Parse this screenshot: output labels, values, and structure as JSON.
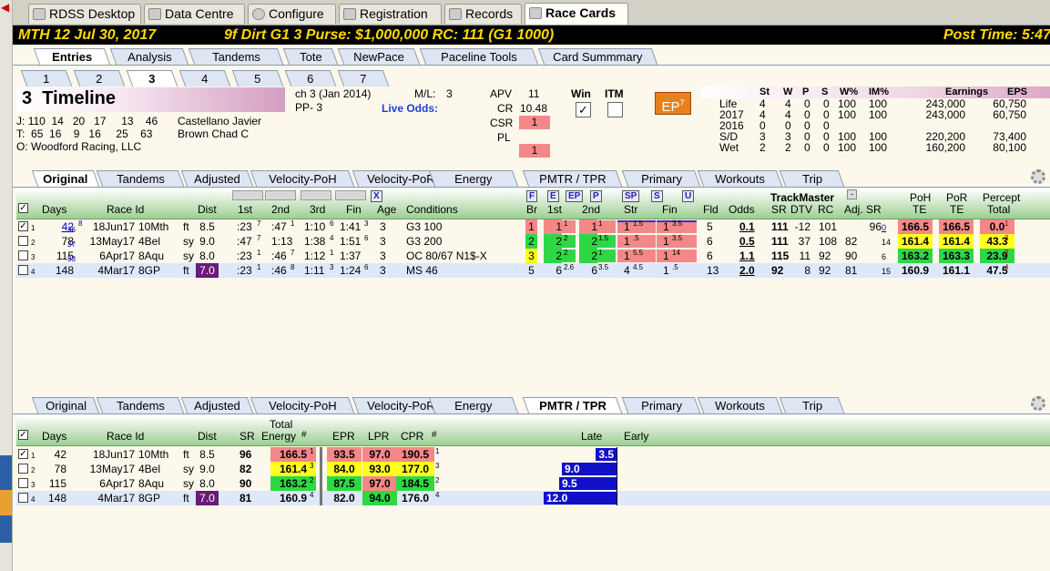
{
  "app_tabs": [
    "RDSS Desktop",
    "Data Centre",
    "Configure",
    "Registration",
    "Records",
    "Race Cards"
  ],
  "header": {
    "left": "MTH  12  Jul 30, 2017",
    "mid": "9f  Dirt   G1  3   Purse: $1,000,000   RC: 111  (G1 1000)",
    "right": "Post Time: 5:47"
  },
  "main_tabs": [
    "Entries",
    "Analysis",
    "Tandems",
    "Tote",
    "NewPace",
    "Paceline Tools",
    "Card Summmary"
  ],
  "race_tabs": [
    "1",
    "2",
    "3",
    "4",
    "5",
    "6",
    "7"
  ],
  "horse": {
    "num": "3",
    "name": "Timeline",
    "j_label": "J:",
    "j_stats": "110  14   20   17     13    46",
    "jockey": "Castellano Javier",
    "t_label": "T:",
    "t_stats": " 65  16    9   16     25    63",
    "trainer": "Brown Chad C",
    "o_label": "O:",
    "owner": "Woodford Racing, LLC",
    "desc": "ch  3  (Jan 2014)",
    "pp": "PP- 3",
    "ml_label": "M/L:",
    "ml": "3",
    "live_odds": "Live Odds:",
    "apv_label": "APV",
    "apv": "11",
    "cr_label": "CR",
    "cr": "10.48",
    "csr_label": "CSR",
    "csr": "1",
    "pl_label": "PL",
    "pl": "1",
    "win_label": "Win",
    "itm_label": "ITM",
    "ep_label": "EP",
    "ep_sup": "7"
  },
  "stats": {
    "headers": [
      "St",
      "W",
      "P",
      "S",
      "W%",
      "IM%",
      "Earnings",
      "EPS"
    ],
    "rows": [
      [
        "Life",
        "4",
        "4",
        "0",
        "0",
        "100",
        "100",
        "243,000",
        "60,750"
      ],
      [
        "2017",
        "4",
        "4",
        "0",
        "0",
        "100",
        "100",
        "243,000",
        "60,750"
      ],
      [
        "2016",
        "0",
        "0",
        "0",
        "0",
        "",
        "",
        "",
        ""
      ],
      [
        "S/D",
        "3",
        "3",
        "0",
        "0",
        "100",
        "100",
        "220,200",
        "73,400"
      ],
      [
        "Wet",
        "2",
        "2",
        "0",
        "0",
        "100",
        "100",
        "160,200",
        "80,100"
      ]
    ]
  },
  "pp_tabs": [
    "Original",
    "Tandems",
    "Adjusted",
    "Velocity-PoH",
    "Velocity-PoR",
    "Energy",
    "PMTR / TPR",
    "Primary",
    "Workouts",
    "Trip"
  ],
  "grid1": {
    "headers": {
      "days": "Days",
      "raceid": "Race Id",
      "dist": "Dist",
      "c1": "1st",
      "c2": "2nd",
      "c3": "3rd",
      "fin": "Fin",
      "age": "Age",
      "cond": "Conditions",
      "br": "Br",
      "first": "1st",
      "second": "2nd",
      "str": "Str",
      "fin2": "Fin",
      "fld": "Fld",
      "odds": "Odds",
      "tm": "TrackMaster",
      "sr": "SR",
      "dtv": "DTV",
      "rc": "RC",
      "adjsr": "Adj. SR",
      "poh": "PoH",
      "te": "TE",
      "por": "PoR",
      "te2": "TE",
      "percept": "Percept",
      "total": "Total",
      "f": "F",
      "e": "E",
      "ep": "EP",
      "p": "P",
      "sp": "SP",
      "s": "S",
      "u": "U",
      "x": "X",
      "minus": "-"
    },
    "rows": [
      {
        "n": "1",
        "days": "42",
        "dsup": "8",
        "dsub": "36",
        "date": "18Jun17",
        "trk": "10Mth",
        "surf": "ft",
        "dist": "8.5",
        "t1": ":23",
        "t1s": "7",
        "t2": ":47",
        "t2s": "1",
        "t3": "1:10",
        "t3s": "6",
        "fin": "1:41",
        "fins": "3",
        "age": "3",
        "cond": "G3 100",
        "br": "1",
        "f1": "1",
        "f1s": "1",
        "s2": "1",
        "s2s": "1",
        "st": "1",
        "sts": "1.5",
        "fn": "1",
        "fns": "3.5",
        "fld": "5",
        "odds": "0.1",
        "sr": "111",
        "dtv": "-12",
        "rc": "101",
        "adj": "96",
        "adjs": "0",
        "poh": "166.5",
        "por": "166.5",
        "pct": "0.0",
        "pcts": "1"
      },
      {
        "n": "2",
        "days": "78",
        "dsup": "",
        "dsub": "37",
        "date": "13May17",
        "trk": "4Bel",
        "surf": "sy",
        "dist": "9.0",
        "t1": ":47",
        "t1s": "7",
        "t2": "1:13",
        "t2s": "",
        "t3": "1:38",
        "t3s": "4",
        "fin": "1:51",
        "fins": "6",
        "age": "3",
        "cond": "G3 200",
        "br": "2",
        "f1": "2",
        "f1s": "2",
        "s2": "2",
        "s2s": "1.5",
        "st": "1",
        "sts": ".5",
        "fn": "1",
        "fns": "3.5",
        "fld": "6",
        "odds": "0.5",
        "sr": "111",
        "dtv": "37",
        "rc": "108",
        "adj": "82",
        "adjs": "14",
        "poh": "161.4",
        "por": "161.4",
        "pct": "43.3",
        "pcts": "3"
      },
      {
        "n": "3",
        "days": "115",
        "dsup": "",
        "dsub": "33",
        "date": "6Apr17",
        "trk": "8Aqu",
        "surf": "sy",
        "dist": "8.0",
        "t1": ":23",
        "t1s": "1",
        "t2": ":46",
        "t2s": "7",
        "t3": "1:12",
        "t3s": "1",
        "fin": "1:37",
        "fins": "",
        "age": "3",
        "cond": "OC 80/67 N1$-X",
        "br": "3",
        "f1": "2",
        "f1s": "2",
        "s2": "2",
        "s2s": "1",
        "st": "1",
        "sts": "5.5",
        "fn": "1",
        "fns": "14",
        "fld": "6",
        "odds": "1.1",
        "sr": "115",
        "dtv": "11",
        "rc": "92",
        "adj": "90",
        "adjs": "6",
        "poh": "163.2",
        "por": "163.3",
        "pct": "23.9",
        "pcts": "2"
      },
      {
        "n": "4",
        "days": "148",
        "dsup": "",
        "dsub": "",
        "date": "4Mar17",
        "trk": "8GP",
        "surf": "ft",
        "dist": "7.0",
        "t1": ":23",
        "t1s": "1",
        "t2": ":46",
        "t2s": "8",
        "t3": "1:11",
        "t3s": "3",
        "fin": "1:24",
        "fins": "6",
        "age": "3",
        "cond": "MS 46",
        "br": "5",
        "f1": "6",
        "f1s": "2.6",
        "s2": "6",
        "s2s": "3.5",
        "st": "4",
        "sts": "4.5",
        "fn": "1",
        "fns": ".5",
        "fld": "13",
        "odds": "2.0",
        "sr": "92",
        "dtv": "8",
        "rc": "92",
        "adj": "81",
        "adjs": "15",
        "poh": "160.9",
        "por": "161.1",
        "pct": "47.5",
        "pcts": "4"
      }
    ]
  },
  "grid2": {
    "headers": {
      "days": "Days",
      "raceid": "Race Id",
      "dist": "Dist",
      "sr": "SR",
      "total": "Total",
      "energy": "Energy",
      "hash": "#",
      "epr": "EPR",
      "lpr": "LPR",
      "cpr": "CPR",
      "hash2": "#",
      "late": "Late",
      "early": "Early"
    },
    "rows": [
      {
        "n": "1",
        "days": "42",
        "date": "18Jun17",
        "trk": "10Mth",
        "surf": "ft",
        "dist": "8.5",
        "sr": "96",
        "en": "166.5",
        "ens": "1",
        "epr": "93.5",
        "lpr": "97.0",
        "cpr": "190.5",
        "cprs": "1",
        "bar": "3.5"
      },
      {
        "n": "2",
        "days": "78",
        "date": "13May17",
        "trk": "4Bel",
        "surf": "sy",
        "dist": "9.0",
        "sr": "82",
        "en": "161.4",
        "ens": "3",
        "epr": "84.0",
        "lpr": "93.0",
        "cpr": "177.0",
        "cprs": "3",
        "bar": "9.0"
      },
      {
        "n": "3",
        "days": "115",
        "date": "6Apr17",
        "trk": "8Aqu",
        "surf": "sy",
        "dist": "8.0",
        "sr": "90",
        "en": "163.2",
        "ens": "2",
        "epr": "87.5",
        "lpr": "97.0",
        "cpr": "184.5",
        "cprs": "2",
        "bar": "9.5"
      },
      {
        "n": "4",
        "days": "148",
        "date": "4Mar17",
        "trk": "8GP",
        "surf": "ft",
        "dist": "7.0",
        "sr": "81",
        "en": "160.9",
        "ens": "4",
        "epr": "82.0",
        "lpr": "94.0",
        "cpr": "176.0",
        "cprs": "4",
        "bar": "12.0"
      }
    ]
  },
  "colors": {
    "header_bg": "#000000",
    "header_fg": "#ffd800",
    "green": "#2ed845",
    "yellow": "#ffff20",
    "pink": "#f48888",
    "purple": "#6a1a78",
    "blue": "#1010c8"
  }
}
